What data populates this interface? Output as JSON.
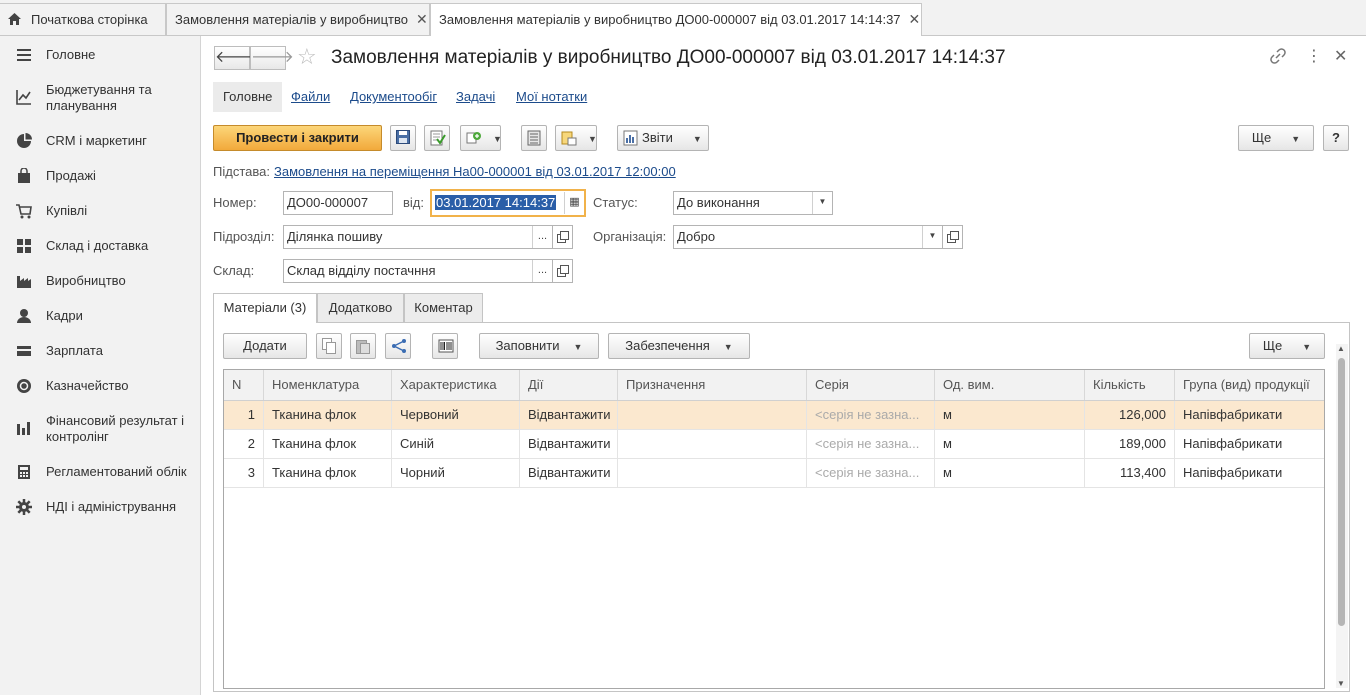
{
  "tabs": {
    "home": "Початкова сторінка",
    "tab1": "Замовлення матеріалів у виробництво",
    "tab2": "Замовлення матеріалів у виробництво ДО00-000007 від 03.01.2017 14:14:37"
  },
  "sidebar": {
    "items": [
      {
        "label": "Головне",
        "icon": "menu-icon"
      },
      {
        "label": "Бюджетування та планування",
        "icon": "chart-icon"
      },
      {
        "label": "CRM і маркетинг",
        "icon": "pie-icon"
      },
      {
        "label": "Продажі",
        "icon": "bag-icon"
      },
      {
        "label": "Купівлі",
        "icon": "cart-icon"
      },
      {
        "label": "Склад і доставка",
        "icon": "grid-icon"
      },
      {
        "label": "Виробництво",
        "icon": "factory-icon"
      },
      {
        "label": "Кадри",
        "icon": "person-icon"
      },
      {
        "label": "Зарплата",
        "icon": "card-icon"
      },
      {
        "label": "Казначейство",
        "icon": "coin-icon"
      },
      {
        "label": "Фінансовий результат і контролінг",
        "icon": "bars-icon"
      },
      {
        "label": "Регламентований облік",
        "icon": "calculator-icon"
      },
      {
        "label": "НДІ і адміністрування",
        "icon": "gear-icon"
      }
    ]
  },
  "document": {
    "title": "Замовлення матеріалів у виробництво ДО00-000007 від 03.01.2017 14:14:37"
  },
  "subtabs": {
    "main": "Головне",
    "files": "Файли",
    "workflow": "Документообіг",
    "tasks": "Задачі",
    "notes": "Мої нотатки"
  },
  "toolbar": {
    "post_close": "Провести і закрити",
    "reports": "Звіти",
    "more": "Ще",
    "help": "?"
  },
  "form": {
    "basis_label": "Підстава:",
    "basis_value": "Замовлення на переміщення На00-000001 від 03.01.2017 12:00:00",
    "number_label": "Номер:",
    "number_value": "ДО00-000007",
    "date_label": "від:",
    "date_value": "03.01.2017 14:14:37",
    "status_label": "Статус:",
    "status_value": "До виконання",
    "division_label": "Підрозділ:",
    "division_value": "Ділянка пошиву",
    "org_label": "Організація:",
    "org_value": "Добро",
    "warehouse_label": "Склад:",
    "warehouse_value": "Склад відділу постачння",
    "ellipsis": "..."
  },
  "detail_tabs": {
    "materials": "Матеріали (3)",
    "additional": "Додатково",
    "comment": "Коментар"
  },
  "table_toolbar": {
    "add": "Додати",
    "fill": "Заповнити",
    "provision": "Забезпечення",
    "more": "Ще"
  },
  "table": {
    "columns": [
      "N",
      "Номенклатура",
      "Характеристика",
      "Дії",
      "Призначення",
      "Серія",
      "Од. вим.",
      "Кількість",
      "Група (вид) продукції"
    ],
    "rows": [
      [
        "1",
        "Тканина флок",
        "Червоний",
        "Відвантажити",
        "",
        "<серія не зазна...",
        "м",
        "126,000",
        "Напівфабрикати"
      ],
      [
        "2",
        "Тканина флок",
        "Синій",
        "Відвантажити",
        "",
        "<серія не зазна...",
        "м",
        "189,000",
        "Напівфабрикати"
      ],
      [
        "3",
        "Тканина флок",
        "Чорний",
        "Відвантажити",
        "",
        "<серія не зазна...",
        "м",
        "113,400",
        "Напівфабрикати"
      ]
    ]
  }
}
